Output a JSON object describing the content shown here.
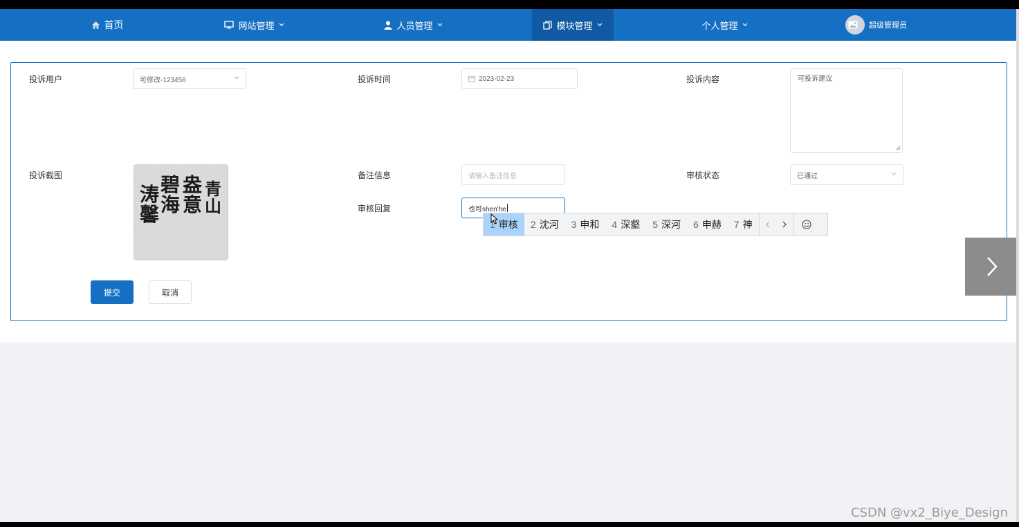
{
  "nav": {
    "home": "首页",
    "site": "网站管理",
    "people": "人员管理",
    "module": "模块管理",
    "personal": "个人管理",
    "user": "超级管理员"
  },
  "form": {
    "user_label": "投诉用户",
    "user_value": "可修改-123456",
    "time_label": "投诉时间",
    "time_value": "2023-02-23",
    "content_label": "投诉内容",
    "content_value": "可投诉建议",
    "screenshot_label": "投诉截图",
    "screenshot_chars": [
      "涛",
      "碧",
      "盎",
      "青",
      "馨",
      "海",
      "意",
      "山"
    ],
    "remark_label": "备注信息",
    "remark_placeholder": "请输入备注信息",
    "status_label": "审核状态",
    "status_value": "已通过",
    "reply_label": "审核回复",
    "reply_value": "也可shen'he",
    "submit": "提交",
    "cancel": "取消"
  },
  "ime": {
    "candidates": [
      {
        "num": "1",
        "text": "审核"
      },
      {
        "num": "2",
        "text": "沈河"
      },
      {
        "num": "3",
        "text": "申和"
      },
      {
        "num": "4",
        "text": "深壑"
      },
      {
        "num": "5",
        "text": "深河"
      },
      {
        "num": "6",
        "text": "申赫"
      },
      {
        "num": "7",
        "text": "神"
      }
    ]
  },
  "watermark": "CSDN @vx2_Biye_Design",
  "colors": {
    "primary": "#1570c4",
    "nav_active": "#0f5aa2",
    "ime_selected": "#a9d3fa"
  }
}
